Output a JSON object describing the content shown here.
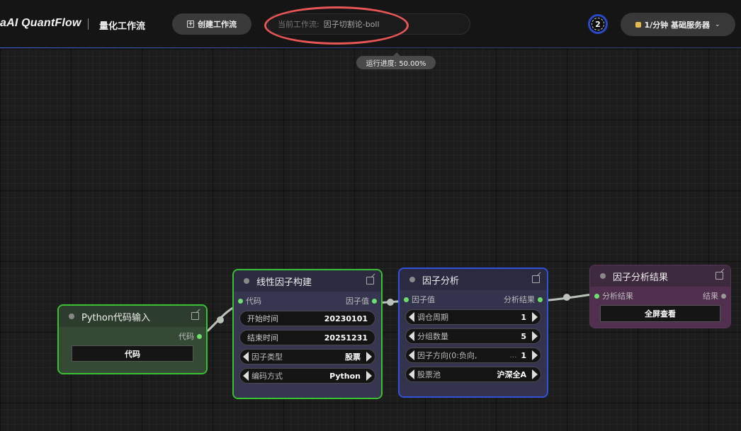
{
  "header": {
    "brand": "aAI QuantFlow",
    "subtitle": "量化工作流",
    "create_label": "创建工作流",
    "current_label": "当前工作流:",
    "current_name": "因子切割论-boll",
    "progress": "运行进度: 50.00%",
    "count": "2",
    "server_label": "1/分钟  基础服务器"
  },
  "nodes": {
    "python": {
      "title": "Python代码输入",
      "output_label": "代码",
      "button_label": "代码"
    },
    "linear": {
      "title": "线性因子构建",
      "input_label": "代码",
      "output_label": "因子值",
      "fields": [
        {
          "label": "开始时间",
          "value": "20230101"
        },
        {
          "label": "结束时间",
          "value": "20251231"
        }
      ],
      "combos": [
        {
          "label": "因子类型",
          "value": "股票"
        },
        {
          "label": "编码方式",
          "value": "Python"
        }
      ]
    },
    "analysis": {
      "title": "因子分析",
      "input_label": "因子值",
      "output_label": "分析结果",
      "combos": [
        {
          "label": "调仓周期",
          "value": "1"
        },
        {
          "label": "分组数量",
          "value": "5"
        },
        {
          "label": "因子方向(0:负向,",
          "value": "1"
        },
        {
          "label": "股票池",
          "value": "沪深全A"
        }
      ]
    },
    "result": {
      "title": "因子分析结果",
      "input_label": "分析结果",
      "output_label": "结果",
      "button_label": "全屏查看"
    }
  },
  "colors": {
    "accent_blue": "#3152d8",
    "node_selected": "#3ac032",
    "highlight": "#e85555"
  }
}
